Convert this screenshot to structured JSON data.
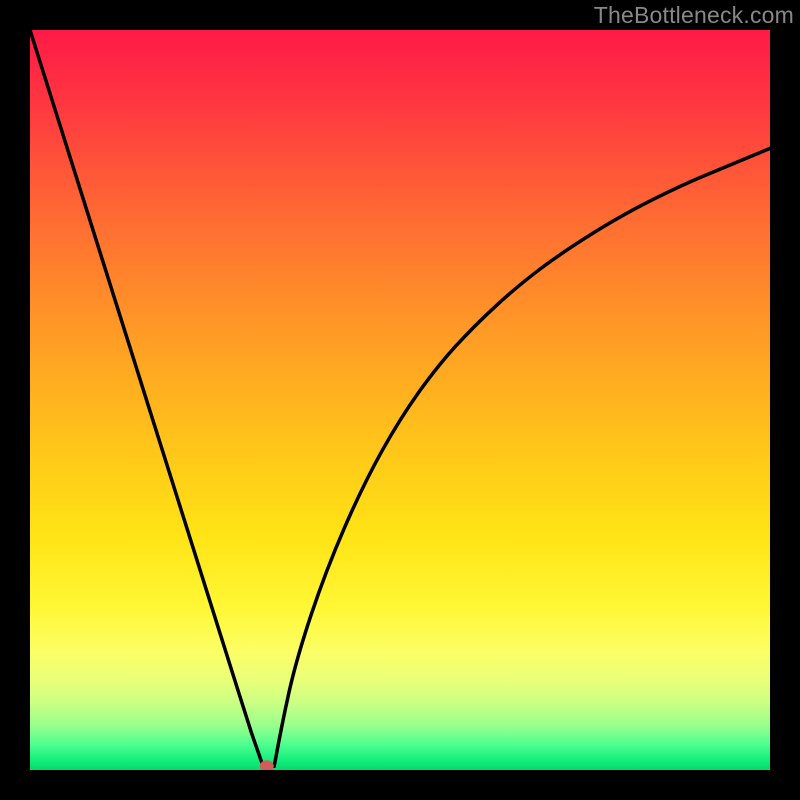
{
  "watermark": "TheBottleneck.com",
  "chart_data": {
    "type": "line",
    "title": "",
    "xlabel": "",
    "ylabel": "",
    "xlim": [
      0,
      100
    ],
    "ylim": [
      0,
      100
    ],
    "grid": false,
    "description": "Bottleneck-shaped curve on a vertical red→orange→yellow→green gradient. Left branch from top-left to a near-zero minimum ~x=32; right branch rises concavely toward ~y=84 on the right.",
    "minimum_marker": {
      "x": 32,
      "y": 0.5,
      "color": "#cf5d5a",
      "radius": 6
    },
    "background_gradient_stops": [
      {
        "offset": 0.0,
        "color": "#ff1a47"
      },
      {
        "offset": 0.1,
        "color": "#ff3740"
      },
      {
        "offset": 0.25,
        "color": "#ff6a33"
      },
      {
        "offset": 0.4,
        "color": "#ff9826"
      },
      {
        "offset": 0.55,
        "color": "#ffc21a"
      },
      {
        "offset": 0.68,
        "color": "#ffe315"
      },
      {
        "offset": 0.78,
        "color": "#fff735"
      },
      {
        "offset": 0.84,
        "color": "#fcff66"
      },
      {
        "offset": 0.88,
        "color": "#e9ff7a"
      },
      {
        "offset": 0.91,
        "color": "#c9ff84"
      },
      {
        "offset": 0.94,
        "color": "#99ff8c"
      },
      {
        "offset": 0.965,
        "color": "#4fff8f"
      },
      {
        "offset": 0.985,
        "color": "#18f07e"
      },
      {
        "offset": 1.0,
        "color": "#06d96e"
      }
    ],
    "series": [
      {
        "name": "left-branch",
        "x": [
          0.0,
          4.0,
          8.0,
          12.0,
          16.0,
          20.0,
          24.0,
          28.0,
          30.0,
          31.5
        ],
        "y": [
          100.0,
          87.3,
          74.6,
          61.9,
          49.2,
          36.5,
          23.8,
          11.1,
          4.8,
          0.5
        ]
      },
      {
        "name": "right-branch",
        "x": [
          33.0,
          34.0,
          36.0,
          40.0,
          45.0,
          50.0,
          55.0,
          60.0,
          66.0,
          72.0,
          80.0,
          88.0,
          94.0,
          100.0
        ],
        "y": [
          0.5,
          6.0,
          15.0,
          27.0,
          38.5,
          47.5,
          54.5,
          60.0,
          65.5,
          70.0,
          75.0,
          79.0,
          81.5,
          84.0
        ]
      }
    ]
  }
}
